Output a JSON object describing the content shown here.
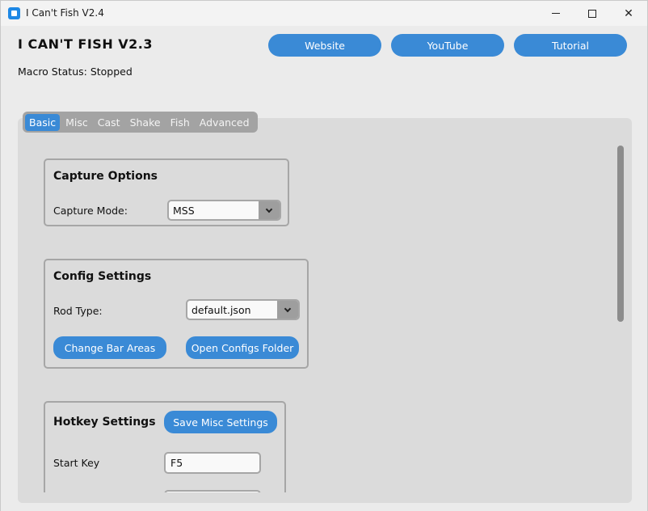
{
  "window": {
    "title": "I Can't Fish V2.4",
    "minimize": "–",
    "maximize": "□",
    "close": "✕"
  },
  "header": {
    "app_title": "I CAN'T FISH V2.3",
    "status": "Macro Status: Stopped",
    "buttons": {
      "website": "Website",
      "youtube": "YouTube",
      "tutorial": "Tutorial"
    }
  },
  "tabs": [
    "Basic",
    "Misc",
    "Cast",
    "Shake",
    "Fish",
    "Advanced"
  ],
  "active_tab": "Basic",
  "capture": {
    "title": "Capture Options",
    "mode_label": "Capture Mode:",
    "mode_value": "MSS"
  },
  "config": {
    "title": "Config Settings",
    "rod_label": "Rod Type:",
    "rod_value": "default.json",
    "change_bar_areas": "Change Bar Areas",
    "open_configs_folder": "Open Configs Folder"
  },
  "hotkey": {
    "title": "Hotkey Settings",
    "save_misc": "Save Misc Settings",
    "start_key_label": "Start Key",
    "start_key_value": "F5"
  },
  "colors": {
    "accent": "#3a8ad6",
    "panel": "#dbdbdb",
    "tabbar": "#a3a3a3"
  }
}
